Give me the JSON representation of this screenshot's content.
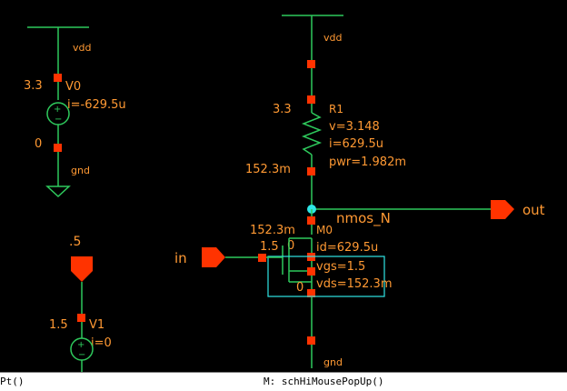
{
  "colors": {
    "background": "#000000",
    "wire": "#2ec95c",
    "pin": "#ff3300",
    "net_label": "#ff9933",
    "value_text": "#ff9933",
    "annotation": "#ff9933",
    "highlight": "#2ee6e6"
  },
  "schematic": {
    "v0": {
      "top_net": "vdd",
      "name": "V0",
      "voltage": "3.3",
      "current": "i=-629.5u",
      "bottom_node": "0",
      "bottom_net": "gnd"
    },
    "r1": {
      "top_net": "vdd",
      "name": "R1",
      "top_node": "3.3",
      "bottom_node": "152.3m",
      "voltage": "v=3.148",
      "current": "i=629.5u",
      "power": "pwr=1.982m"
    },
    "m0": {
      "model": "nmos_N",
      "name": "M0",
      "drain_node": "152.3m",
      "gate_node": "1.5",
      "bulk_node": "0",
      "source_node": "0",
      "id": "id=629.5u",
      "vgs": "vgs=1.5",
      "vds": "vds=152.3m",
      "bottom_net": "gnd"
    },
    "pins": {
      "in": "in",
      "out": "out",
      "v1_top_label": ".5"
    },
    "v1": {
      "name": "V1",
      "voltage": "1.5",
      "current": "i=0"
    }
  },
  "statusbar": {
    "left": "Pt()",
    "right": "M: schHiMousePopUp()"
  }
}
